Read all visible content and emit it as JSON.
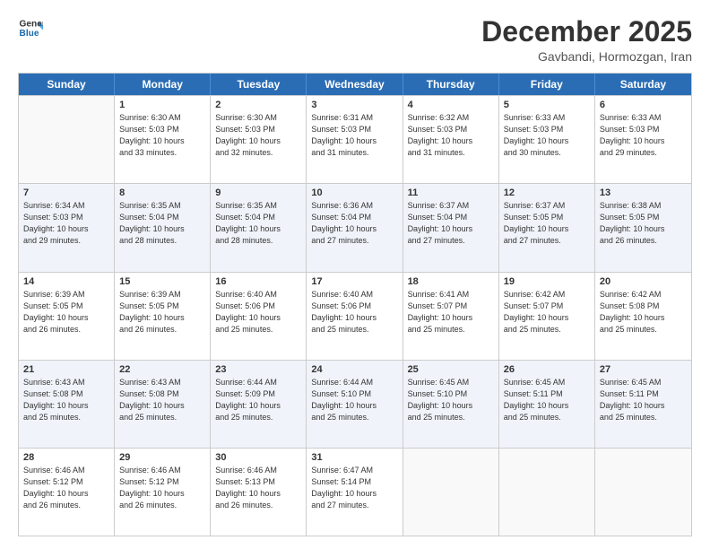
{
  "logo": {
    "line1": "General",
    "line2": "Blue"
  },
  "title": "December 2025",
  "subtitle": "Gavbandi, Hormozgan, Iran",
  "days": [
    "Sunday",
    "Monday",
    "Tuesday",
    "Wednesday",
    "Thursday",
    "Friday",
    "Saturday"
  ],
  "rows": [
    [
      {
        "day": "",
        "info": ""
      },
      {
        "day": "1",
        "info": "Sunrise: 6:30 AM\nSunset: 5:03 PM\nDaylight: 10 hours\nand 33 minutes."
      },
      {
        "day": "2",
        "info": "Sunrise: 6:30 AM\nSunset: 5:03 PM\nDaylight: 10 hours\nand 32 minutes."
      },
      {
        "day": "3",
        "info": "Sunrise: 6:31 AM\nSunset: 5:03 PM\nDaylight: 10 hours\nand 31 minutes."
      },
      {
        "day": "4",
        "info": "Sunrise: 6:32 AM\nSunset: 5:03 PM\nDaylight: 10 hours\nand 31 minutes."
      },
      {
        "day": "5",
        "info": "Sunrise: 6:33 AM\nSunset: 5:03 PM\nDaylight: 10 hours\nand 30 minutes."
      },
      {
        "day": "6",
        "info": "Sunrise: 6:33 AM\nSunset: 5:03 PM\nDaylight: 10 hours\nand 29 minutes."
      }
    ],
    [
      {
        "day": "7",
        "info": "Sunrise: 6:34 AM\nSunset: 5:03 PM\nDaylight: 10 hours\nand 29 minutes."
      },
      {
        "day": "8",
        "info": "Sunrise: 6:35 AM\nSunset: 5:04 PM\nDaylight: 10 hours\nand 28 minutes."
      },
      {
        "day": "9",
        "info": "Sunrise: 6:35 AM\nSunset: 5:04 PM\nDaylight: 10 hours\nand 28 minutes."
      },
      {
        "day": "10",
        "info": "Sunrise: 6:36 AM\nSunset: 5:04 PM\nDaylight: 10 hours\nand 27 minutes."
      },
      {
        "day": "11",
        "info": "Sunrise: 6:37 AM\nSunset: 5:04 PM\nDaylight: 10 hours\nand 27 minutes."
      },
      {
        "day": "12",
        "info": "Sunrise: 6:37 AM\nSunset: 5:05 PM\nDaylight: 10 hours\nand 27 minutes."
      },
      {
        "day": "13",
        "info": "Sunrise: 6:38 AM\nSunset: 5:05 PM\nDaylight: 10 hours\nand 26 minutes."
      }
    ],
    [
      {
        "day": "14",
        "info": "Sunrise: 6:39 AM\nSunset: 5:05 PM\nDaylight: 10 hours\nand 26 minutes."
      },
      {
        "day": "15",
        "info": "Sunrise: 6:39 AM\nSunset: 5:05 PM\nDaylight: 10 hours\nand 26 minutes."
      },
      {
        "day": "16",
        "info": "Sunrise: 6:40 AM\nSunset: 5:06 PM\nDaylight: 10 hours\nand 25 minutes."
      },
      {
        "day": "17",
        "info": "Sunrise: 6:40 AM\nSunset: 5:06 PM\nDaylight: 10 hours\nand 25 minutes."
      },
      {
        "day": "18",
        "info": "Sunrise: 6:41 AM\nSunset: 5:07 PM\nDaylight: 10 hours\nand 25 minutes."
      },
      {
        "day": "19",
        "info": "Sunrise: 6:42 AM\nSunset: 5:07 PM\nDaylight: 10 hours\nand 25 minutes."
      },
      {
        "day": "20",
        "info": "Sunrise: 6:42 AM\nSunset: 5:08 PM\nDaylight: 10 hours\nand 25 minutes."
      }
    ],
    [
      {
        "day": "21",
        "info": "Sunrise: 6:43 AM\nSunset: 5:08 PM\nDaylight: 10 hours\nand 25 minutes."
      },
      {
        "day": "22",
        "info": "Sunrise: 6:43 AM\nSunset: 5:08 PM\nDaylight: 10 hours\nand 25 minutes."
      },
      {
        "day": "23",
        "info": "Sunrise: 6:44 AM\nSunset: 5:09 PM\nDaylight: 10 hours\nand 25 minutes."
      },
      {
        "day": "24",
        "info": "Sunrise: 6:44 AM\nSunset: 5:10 PM\nDaylight: 10 hours\nand 25 minutes."
      },
      {
        "day": "25",
        "info": "Sunrise: 6:45 AM\nSunset: 5:10 PM\nDaylight: 10 hours\nand 25 minutes."
      },
      {
        "day": "26",
        "info": "Sunrise: 6:45 AM\nSunset: 5:11 PM\nDaylight: 10 hours\nand 25 minutes."
      },
      {
        "day": "27",
        "info": "Sunrise: 6:45 AM\nSunset: 5:11 PM\nDaylight: 10 hours\nand 25 minutes."
      }
    ],
    [
      {
        "day": "28",
        "info": "Sunrise: 6:46 AM\nSunset: 5:12 PM\nDaylight: 10 hours\nand 26 minutes."
      },
      {
        "day": "29",
        "info": "Sunrise: 6:46 AM\nSunset: 5:12 PM\nDaylight: 10 hours\nand 26 minutes."
      },
      {
        "day": "30",
        "info": "Sunrise: 6:46 AM\nSunset: 5:13 PM\nDaylight: 10 hours\nand 26 minutes."
      },
      {
        "day": "31",
        "info": "Sunrise: 6:47 AM\nSunset: 5:14 PM\nDaylight: 10 hours\nand 27 minutes."
      },
      {
        "day": "",
        "info": ""
      },
      {
        "day": "",
        "info": ""
      },
      {
        "day": "",
        "info": ""
      }
    ]
  ]
}
